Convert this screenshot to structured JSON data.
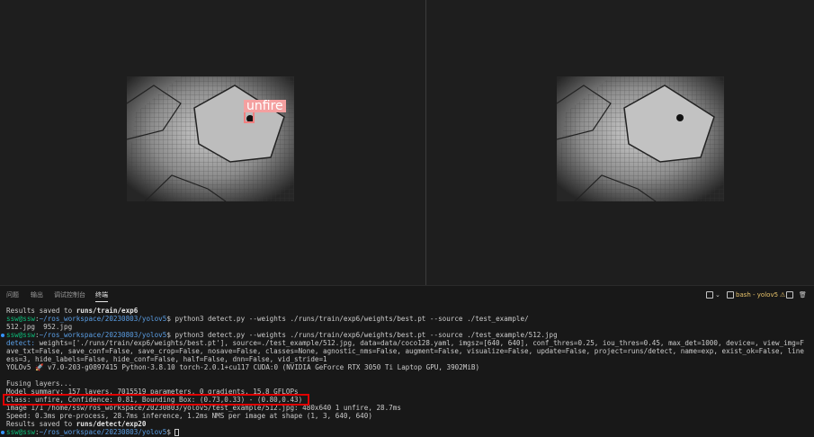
{
  "images": {
    "left": {
      "detection_label": "unfire"
    },
    "right": {}
  },
  "panel": {
    "tabs": [
      "问题",
      "输出",
      "调试控制台",
      "终端"
    ],
    "active_tab": "终端",
    "terminal_name": "bash - yolov5"
  },
  "terminal": {
    "line1": "Results saved to ",
    "line1_bold": "runs/train/exp6",
    "prompt_user": "ssw@ssw",
    "prompt_path": "~/ros_workspace/20230803/yolov5",
    "cmd1": "$ python3 detect.py --weights ./runs/train/exp6/weights/best.pt --source ./test_example/",
    "line3": "512.jpg  952.jpg",
    "cmd2": "$ python3 detect.py --weights ./runs/train/exp6/weights/best.pt --source ./test_example/512.jpg",
    "detect_key": "detect:",
    "detect_val": " weights=['./runs/train/exp6/weights/best.pt'], source=./test_example/512.jpg, data=data/coco128.yaml, imgsz=[640, 640], conf_thres=0.25, iou_thres=0.45, max_det=1000, device=, view_img=F",
    "line6": "ave_txt=False, save_conf=False, save_crop=False, nosave=False, classes=None, agnostic_nms=False, augment=False, visualize=False, update=False, project=runs/detect, name=exp, exist_ok=False, line",
    "line7": "ess=3, hide_labels=False, hide_conf=False, half=False, dnn=False, vid_stride=1",
    "line8": "YOLOv5 🚀 v7.0-203-g0897415 Python-3.8.10 torch-2.0.1+cu117 CUDA:0 (NVIDIA GeForce RTX 3050 Ti Laptop GPU, 3902MiB)",
    "line10": "Fusing layers...",
    "line11": "Model summary: 157 layers, 7015519 parameters, 0 gradients, 15.8 GFLOPs",
    "line12": "Class: unfire, Confidence: 0.81, Bounding Box: (0.73,0.33) - (0.80,0.43)",
    "line13": "image 1/1 /home/ssw/ros_workspace/20230803/yolov5/test_example/512.jpg: 480x640 1 unfire, 28.7ms",
    "line14": "Speed: 0.3ms pre-process, 28.7ms inference, 1.2ms NMS per image at shape (1, 3, 640, 640)",
    "line15": "Results saved to ",
    "line15_bold": "runs/detect/exp20",
    "prompt_tail": "$ "
  },
  "colors": {
    "prompt_green": "#0dbc79",
    "path_blue": "#5b9fe6",
    "highlight_red": "#e00000",
    "box_pink": "#f08080"
  }
}
